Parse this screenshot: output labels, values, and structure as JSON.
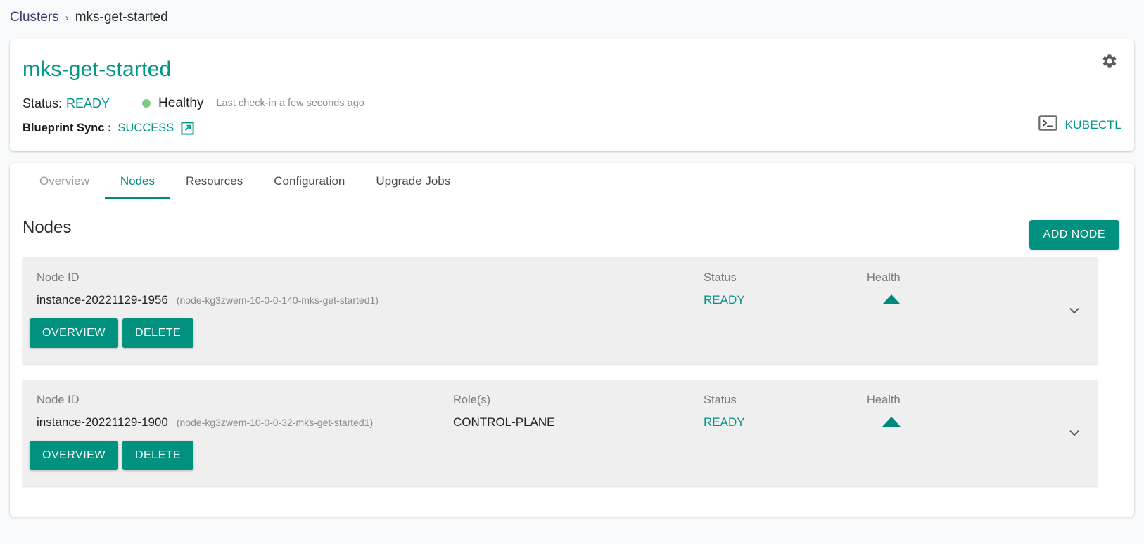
{
  "breadcrumb": {
    "root_label": "Clusters",
    "separator": "›",
    "current_label": "mks-get-started"
  },
  "header": {
    "title": "mks-get-started",
    "status_label": "Status:",
    "status_value": "READY",
    "health_text": "Healthy",
    "checkin_text": "Last check-in a few seconds ago",
    "blueprint_label": "Blueprint Sync :",
    "blueprint_value": "SUCCESS",
    "external_link_icon": "external-link-icon",
    "gear_icon": "gear-icon",
    "kubectl_label": "KUBECTL",
    "kubectl_icon": "terminal-icon",
    "health_dot_color": "#81c784",
    "accent_color": "#009688"
  },
  "tabs": [
    {
      "label": "Overview",
      "state": "dim"
    },
    {
      "label": "Nodes",
      "state": "active"
    },
    {
      "label": "Resources",
      "state": "normal"
    },
    {
      "label": "Configuration",
      "state": "normal"
    },
    {
      "label": "Upgrade Jobs",
      "state": "normal"
    }
  ],
  "nodes_section": {
    "title": "Nodes",
    "add_node_label": "ADD NODE",
    "columns": {
      "node_id": "Node ID",
      "roles": "Role(s)",
      "status": "Status",
      "health": "Health"
    },
    "row_actions": {
      "overview_label": "OVERVIEW",
      "delete_label": "DELETE"
    },
    "rows": [
      {
        "node_id": "instance-20221129-1956",
        "node_alias": "(node-kg3zwem-10-0-0-140-mks-get-started1)",
        "roles": "",
        "status": "READY",
        "health_icon": "triangle-up-icon",
        "expand_icon": "chevron-down-icon"
      },
      {
        "node_id": "instance-20221129-1900",
        "node_alias": "(node-kg3zwem-10-0-0-32-mks-get-started1)",
        "roles": "CONTROL-PLANE",
        "status": "READY",
        "health_icon": "triangle-up-icon",
        "expand_icon": "chevron-down-icon"
      }
    ]
  }
}
